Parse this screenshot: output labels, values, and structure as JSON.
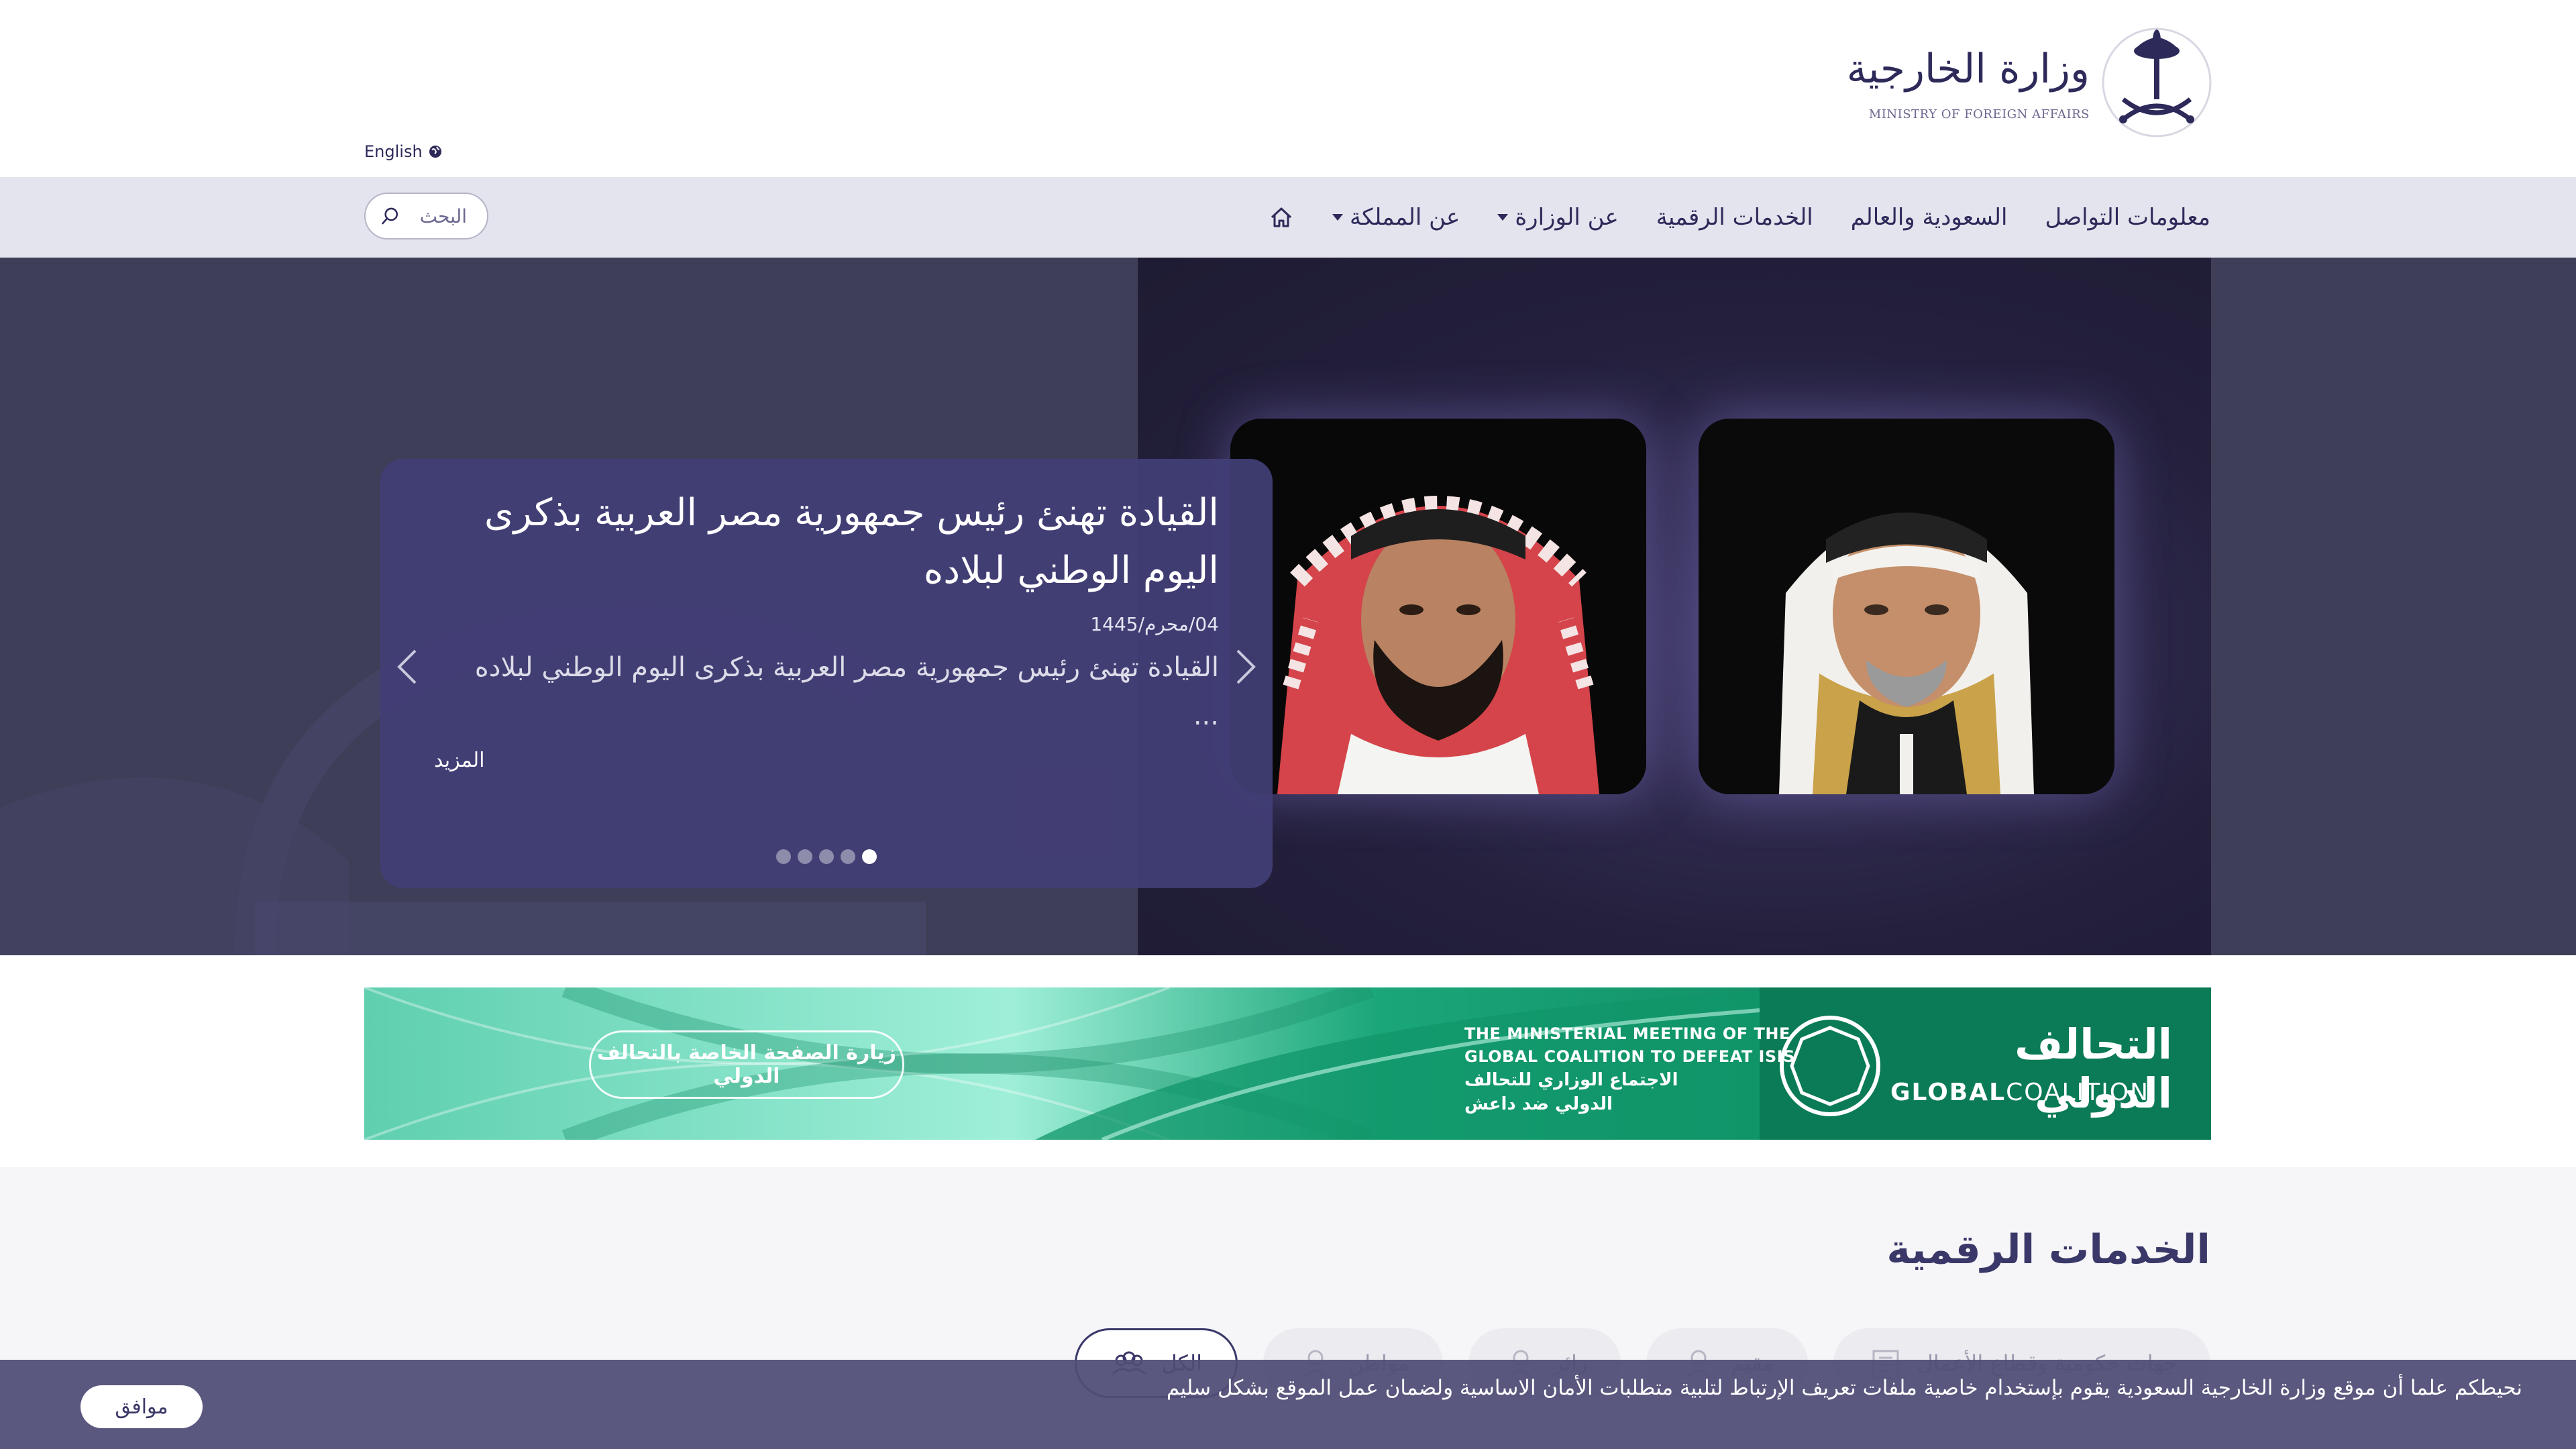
{
  "header": {
    "logo_ar": "وزارة الخارجية",
    "logo_en": "MINISTRY OF FOREIGN AFFAIRS",
    "language_label": "English"
  },
  "nav": {
    "items": [
      {
        "label": "عن المملكة",
        "has_dropdown": true
      },
      {
        "label": "عن الوزارة",
        "has_dropdown": true
      },
      {
        "label": "الخدمات الرقمية",
        "has_dropdown": false
      },
      {
        "label": "السعودية والعالم",
        "has_dropdown": false
      },
      {
        "label": "معلومات التواصل",
        "has_dropdown": false
      }
    ],
    "search_placeholder": "البحث"
  },
  "hero": {
    "title": "القيادة تهنئ رئيس جمهورية مصر العربية بذكرى اليوم الوطني لبلاده",
    "date": "04/محرم/1445",
    "summary": "القيادة تهنئ رئيس جمهورية مصر العربية بذكرى اليوم الوطني لبلاده ...",
    "more_label": "المزيد",
    "slide_count": 5,
    "active_slide": 1
  },
  "banner": {
    "button_label": "زيارة الصفحة الخاصة بالتحالف الدولي",
    "en_text": "THE MINISTERIAL MEETING OF THE\nGLOBAL COALITION TO DEFEAT ISIS",
    "ar_small_text": "الاجتماع الوزاري للتحالف\nالدولي ضد داعش",
    "brand_ar": "التحالف الدولي",
    "brand_en_bold": "GLOBAL",
    "brand_en_light": "COALITION"
  },
  "services": {
    "title": "الخدمات الرقمية",
    "filters": [
      {
        "label": "الكل",
        "icon": "group-icon",
        "active": true
      },
      {
        "label": "مواطن",
        "icon": "person-icon",
        "active": false
      },
      {
        "label": "زائر",
        "icon": "visitor-icon",
        "active": false
      },
      {
        "label": "مقيم",
        "icon": "resident-icon",
        "active": false
      },
      {
        "label": "جهات حكومية وقطاع الأعمال",
        "icon": "building-icon",
        "active": false
      }
    ]
  },
  "cookie": {
    "message": "نحيطكم علما أن موقع وزارة الخارجية السعودية يقوم بإستخدام خاصية ملفات تعريف الإرتباط لتلبية متطلبات الأمان الاساسية ولضمان عمل الموقع بشكل سليم",
    "accept_label": "موافق"
  },
  "colors": {
    "primary": "#2d2a5a",
    "nav_bg": "#e4e4ee",
    "hero_card": "#423e76",
    "banner_green": "#0e8a5f",
    "banner_mint": "#6fe0c0"
  }
}
